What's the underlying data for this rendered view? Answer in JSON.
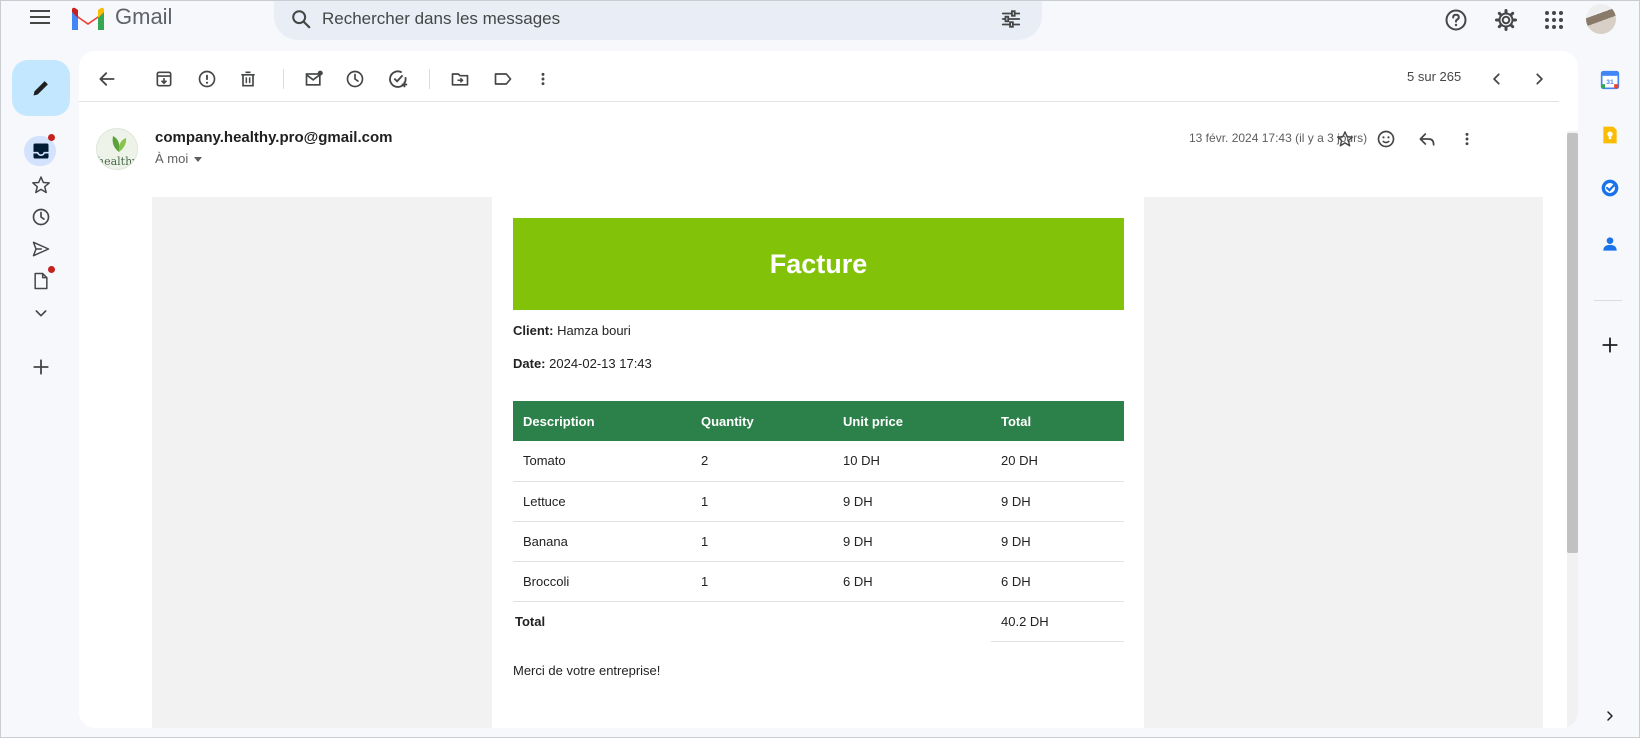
{
  "app": {
    "name": "Gmail"
  },
  "search": {
    "placeholder": "Rechercher dans les messages"
  },
  "toolbar": {
    "pager": "5 sur 265",
    "actions": [
      "back-icon",
      "archive-icon",
      "report-spam-icon",
      "delete-icon",
      "mark-unread-icon",
      "snooze-icon",
      "add-task-icon",
      "move-to-icon",
      "label-icon",
      "more-vert-icon"
    ]
  },
  "message": {
    "sender": "company.healthy.pro@gmail.com",
    "recipient": "À moi",
    "avatar_text": "healthy",
    "date": "13 févr. 2024 17:43 (il y a 3 jours)"
  },
  "invoice": {
    "title": "Facture",
    "client_label": "Client:",
    "client_value": " Hamza bouri",
    "date_label": "Date:",
    "date_value": " 2024-02-13 17:43",
    "columns": [
      "Description",
      "Quantity",
      "Unit price",
      "Total"
    ],
    "rows": [
      {
        "description": "Tomato",
        "quantity": "2",
        "unit_price": "10 DH",
        "total": "20 DH"
      },
      {
        "description": "Lettuce",
        "quantity": "1",
        "unit_price": "9 DH",
        "total": "9 DH"
      },
      {
        "description": "Banana",
        "quantity": "1",
        "unit_price": "9 DH",
        "total": "9 DH"
      },
      {
        "description": "Broccoli",
        "quantity": "1",
        "unit_price": "6 DH",
        "total": "6 DH"
      }
    ],
    "total_label": "Total",
    "total_value": "40.2 DH",
    "thanks": "Merci de votre entreprise!"
  },
  "colors": {
    "invoice_header": "#82c30a",
    "table_header": "#2c8049",
    "compose_bg": "#c2e7ff",
    "unread_dot": "#c5221f"
  }
}
